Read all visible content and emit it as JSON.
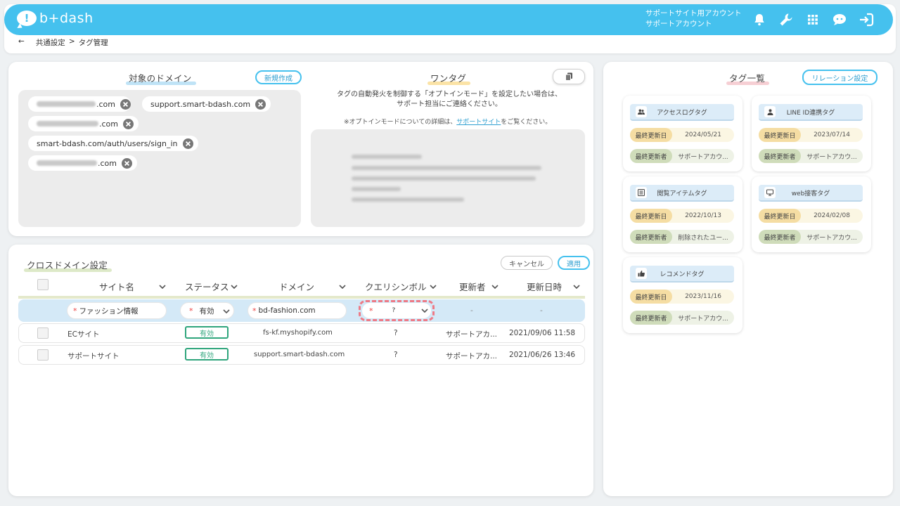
{
  "header": {
    "logo_text": "b+dash",
    "account_line1": "サポートサイト用アカウント",
    "account_line2": "サポートアカウント",
    "icons": [
      "bell-icon",
      "wrench-icon",
      "apps-grid-icon",
      "chat-bot-icon",
      "logout-icon"
    ]
  },
  "breadcrumb": {
    "back": "←",
    "level1": "共通設定",
    "sep": ">",
    "level2": "タグ管理"
  },
  "domain_section": {
    "title": "対象のドメイン",
    "new_button": "新規作成",
    "chips": [
      {
        "suffix": ".com"
      },
      {
        "suffix": "support.smart-bdash.com"
      },
      {
        "suffix": ".com"
      },
      {
        "suffix": "smart-bdash.com/auth/users/sign_in"
      },
      {
        "suffix": ".com"
      }
    ]
  },
  "onetag_section": {
    "title": "ワンタグ",
    "desc_line1": "タグの自動発火を制御する「オプトインモード」を設定したい場合は、",
    "desc_line2": "サポート担当にご連絡ください。",
    "note_prefix": "※オプトインモードについての詳細は、",
    "note_link": "サポートサイト",
    "note_suffix": "をご覧ください。"
  },
  "cross_domain": {
    "title": "クロスドメイン設定",
    "cancel_button": "キャンセル",
    "apply_button": "適用",
    "columns": [
      "サイト名",
      "ステータス",
      "ドメイン",
      "クエリシンボル",
      "更新者",
      "更新日時"
    ],
    "edit_row": {
      "site_name": "ファッション情報",
      "status": "有効",
      "domain": "bd-fashion.com",
      "query_symbol": "?",
      "updater": "-",
      "updated_at": "-"
    },
    "rows": [
      {
        "site_name": "ECサイト",
        "status": "有効",
        "domain": "fs-kf.myshopify.com",
        "query_symbol": "?",
        "updater": "サポートアカ...",
        "updated_at": "2021/09/06 11:58"
      },
      {
        "site_name": "サポートサイト",
        "status": "有効",
        "domain": "support.smart-bdash.com",
        "query_symbol": "?",
        "updater": "サポートアカ...",
        "updated_at": "2021/06/26 13:46"
      }
    ]
  },
  "tag_list": {
    "title": "タグ一覧",
    "relation_button": "リレーション設定",
    "date_label": "最終更新日",
    "user_label": "最終更新者",
    "tags": [
      {
        "name": "アクセスログタグ",
        "icon": "users-icon",
        "date": "2024/05/21",
        "user": "サポートアカウ..."
      },
      {
        "name": "LINE ID連携タグ",
        "icon": "user-icon",
        "date": "2023/07/14",
        "user": "サポートアカウ..."
      },
      {
        "name": "閲覧アイテムタグ",
        "icon": "list-icon",
        "date": "2022/10/13",
        "user": "削除されたユー..."
      },
      {
        "name": "web接客タグ",
        "icon": "monitor-icon",
        "date": "2024/02/08",
        "user": "サポートアカウ..."
      },
      {
        "name": "レコメンドタグ",
        "icon": "thumbs-up-icon",
        "date": "2023/11/16",
        "user": "サポートアカウ..."
      }
    ]
  }
}
